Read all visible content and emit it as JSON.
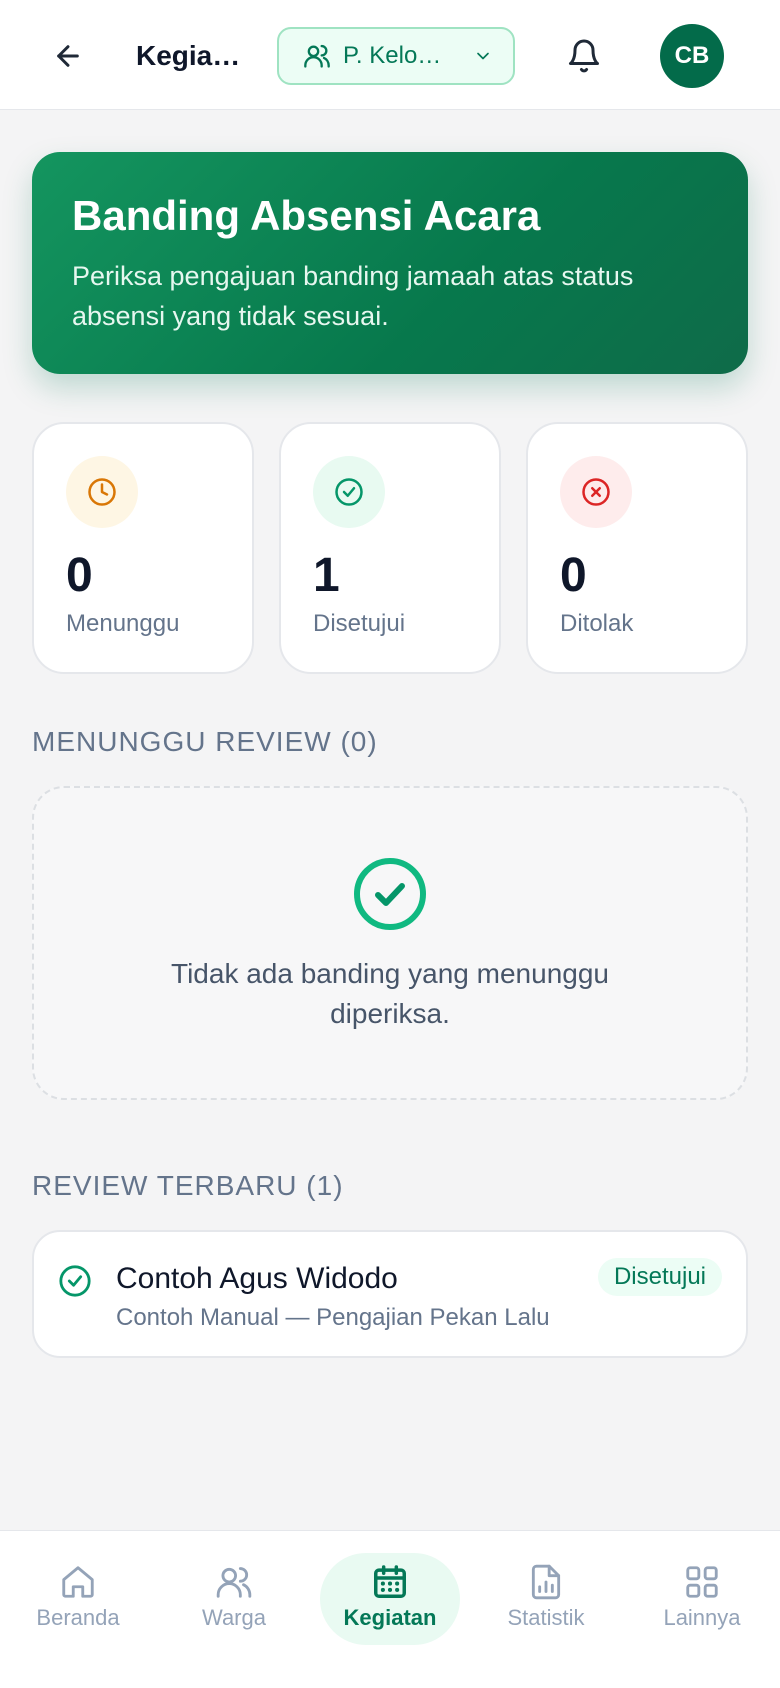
{
  "header": {
    "title": "Kegiatan",
    "group_label": "P. Kelompok",
    "avatar_initials": "CB"
  },
  "hero": {
    "title": "Banding Absensi Acara",
    "description": "Periksa pengajuan banding jamaah atas status absensi yang tidak sesuai."
  },
  "stats": [
    {
      "value": "0",
      "label": "Menunggu",
      "icon": "clock-icon",
      "color": "#d97706",
      "bg": "#fef6e4"
    },
    {
      "value": "1",
      "label": "Disetujui",
      "icon": "check-circle-icon",
      "color": "#059669",
      "bg": "#e8faf1"
    },
    {
      "value": "0",
      "label": "Ditolak",
      "icon": "x-circle-icon",
      "color": "#dc2626",
      "bg": "#feecec"
    }
  ],
  "pending": {
    "title": "MENUNGGU REVIEW (0)",
    "empty_text": "Tidak ada banding yang menunggu diperiksa."
  },
  "recent": {
    "title": "REVIEW TERBARU (1)",
    "items": [
      {
        "name": "Contoh Agus Widodo",
        "subtitle": "Contoh Manual — Pengajian Pekan Lalu",
        "status": "Disetujui"
      }
    ]
  },
  "nav": {
    "items": [
      {
        "label": "Beranda",
        "icon": "home-icon"
      },
      {
        "label": "Warga",
        "icon": "users-icon"
      },
      {
        "label": "Kegiatan",
        "icon": "calendar-icon",
        "active": true
      },
      {
        "label": "Statistik",
        "icon": "chart-file-icon"
      },
      {
        "label": "Lainnya",
        "icon": "grid-icon"
      }
    ]
  },
  "colors": {
    "brand": "#047857",
    "hero_start": "#14955f",
    "accent_light": "#ecfdf5"
  }
}
